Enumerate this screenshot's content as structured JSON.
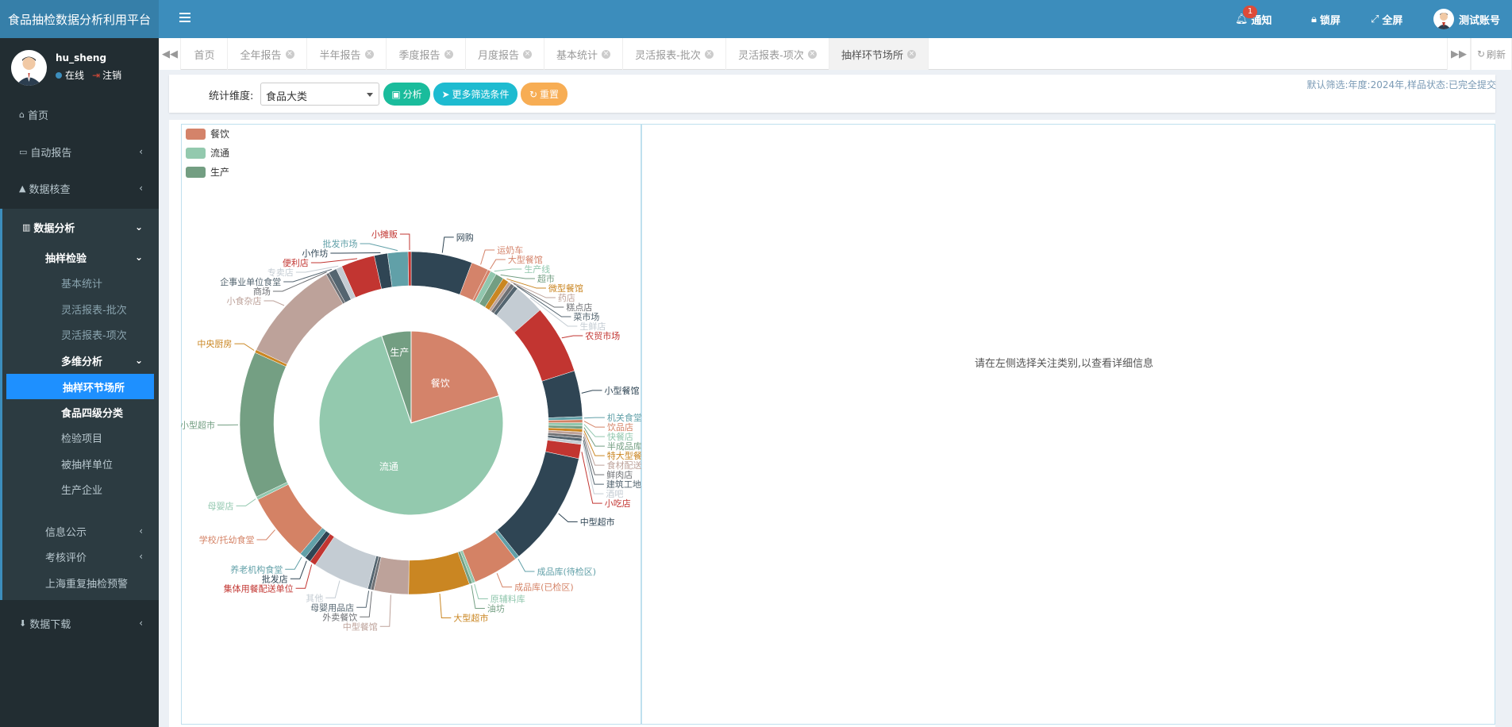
{
  "app": {
    "title": "食品抽检数据分析利用平台"
  },
  "topnav": {
    "notify": "通知",
    "notify_count": "1",
    "lock": "锁屏",
    "fullscreen": "全屏",
    "account": "测试账号"
  },
  "user": {
    "name": "hu_sheng",
    "status": "在线",
    "logout": "注销"
  },
  "sidebar": {
    "home": "首页",
    "auto_report": "自动报告",
    "data_check": "数据核查",
    "data_analysis": "数据分析",
    "sampling": "抽样检验",
    "basic_stats": "基本统计",
    "flex_batch": "灵活报表-批次",
    "flex_item": "灵活报表-项次",
    "multi": "多维分析",
    "sample_site": "抽样环节场所",
    "food_class": "食品四级分类",
    "test_item": "检验项目",
    "sampled_unit": "被抽样单位",
    "producer": "生产企业",
    "info_pub": "信息公示",
    "assessment": "考核评价",
    "shanghai": "上海重复抽检预警",
    "download": "数据下载"
  },
  "tabs": [
    "首页",
    "全年报告",
    "半年报告",
    "季度报告",
    "月度报告",
    "基本统计",
    "灵活报表-批次",
    "灵活报表-项次",
    "抽样环节场所"
  ],
  "refresh": "刷新",
  "filter": {
    "label": "统计维度:",
    "select_value": "食品大类",
    "analyze": "分析",
    "more": "更多筛选条件",
    "reset": "重置",
    "default_note": "默认筛选:年度:2024年,样品状态:已完全提交"
  },
  "detail_hint": "请在左侧选择关注类别,以查看详细信息",
  "colors": {
    "catering": "#d4836a",
    "circulation": "#93c9ae",
    "production": "#739e82",
    "primary": "#3c8dbc"
  },
  "chart_data": {
    "type": "pie",
    "legend": [
      "餐饮",
      "流通",
      "生产"
    ],
    "legend_position": "top-left",
    "inner": [
      {
        "name": "餐饮",
        "value": 20.2
      },
      {
        "name": "流通",
        "value": 74.6
      },
      {
        "name": "生产",
        "value": 5.2
      }
    ],
    "outer": [
      {
        "name": "网购",
        "value": 6.0,
        "color": "#2f4554"
      },
      {
        "name": "运奶车",
        "value": 1.7,
        "color": "#d4836a"
      },
      {
        "name": "大型餐馆",
        "value": 0.3,
        "color": "#d4836a"
      },
      {
        "name": "生产线",
        "value": 0.6,
        "color": "#91c7ae"
      },
      {
        "name": "超市",
        "value": 0.8,
        "color": "#739e82"
      },
      {
        "name": "微型餐馆",
        "value": 0.6,
        "color": "#ca8622"
      },
      {
        "name": "药店",
        "value": 0.3,
        "color": "#bda29a"
      },
      {
        "name": "糕点店",
        "value": 0.4,
        "color": "#6e7074"
      },
      {
        "name": "菜市场",
        "value": 0.4,
        "color": "#546570"
      },
      {
        "name": "生鲜店",
        "value": 3.0,
        "color": "#c4ccd3"
      },
      {
        "name": "农贸市场",
        "value": 6.8,
        "color": "#c23531"
      },
      {
        "name": "小型餐馆",
        "value": 4.5,
        "color": "#2f4554"
      },
      {
        "name": "机关食堂",
        "value": 0.3,
        "color": "#61a0a8"
      },
      {
        "name": "饮品店",
        "value": 0.3,
        "color": "#d48265"
      },
      {
        "name": "快餐店",
        "value": 0.3,
        "color": "#91c7ae"
      },
      {
        "name": "半成品库",
        "value": 0.3,
        "color": "#749f83"
      },
      {
        "name": "特大型餐馆",
        "value": 0.3,
        "color": "#ca8622"
      },
      {
        "name": "食材配送",
        "value": 0.3,
        "color": "#bda29a"
      },
      {
        "name": "鲜肉店",
        "value": 0.3,
        "color": "#6e7074"
      },
      {
        "name": "建筑工地",
        "value": 0.3,
        "color": "#546570"
      },
      {
        "name": "酒吧",
        "value": 0.3,
        "color": "#c4ccd3"
      },
      {
        "name": "小吃店",
        "value": 1.4,
        "color": "#c23531"
      },
      {
        "name": "中型超市",
        "value": 11.3,
        "color": "#2f4554"
      },
      {
        "name": "成品库(待检区)",
        "value": 0.4,
        "color": "#61a0a8"
      },
      {
        "name": "成品库(已检区)",
        "value": 4.5,
        "color": "#d48265"
      },
      {
        "name": "原辅料库",
        "value": 0.3,
        "color": "#91c7ae"
      },
      {
        "name": "油坊",
        "value": 0.3,
        "color": "#749f83"
      },
      {
        "name": "大型超市",
        "value": 6.0,
        "color": "#ca8622"
      },
      {
        "name": "中型餐馆",
        "value": 3.4,
        "color": "#bda29a"
      },
      {
        "name": "外卖餐饮",
        "value": 0.3,
        "color": "#6e7074"
      },
      {
        "name": "母婴用品店",
        "value": 0.3,
        "color": "#546570"
      },
      {
        "name": "其他",
        "value": 5.6,
        "color": "#c4ccd3"
      },
      {
        "name": "集体用餐配送单位",
        "value": 0.6,
        "color": "#c23531"
      },
      {
        "name": "批发店",
        "value": 0.6,
        "color": "#2f4554"
      },
      {
        "name": "养老机构食堂",
        "value": 0.6,
        "color": "#61a0a8"
      },
      {
        "name": "学校/托幼食堂",
        "value": 6.7,
        "color": "#d48265"
      },
      {
        "name": "母婴店",
        "value": 0.3,
        "color": "#91c7ae"
      },
      {
        "name": "小型超市",
        "value": 14.4,
        "color": "#749f83"
      },
      {
        "name": "中央厨房",
        "value": 0.3,
        "color": "#ca8622"
      },
      {
        "name": "小食杂店",
        "value": 10.1,
        "color": "#bda29a"
      },
      {
        "name": "商场",
        "value": 0.3,
        "color": "#6e7074"
      },
      {
        "name": "企事业单位食堂",
        "value": 0.8,
        "color": "#546570"
      },
      {
        "name": "专卖店",
        "value": 0.6,
        "color": "#c4ccd3"
      },
      {
        "name": "便利店",
        "value": 3.3,
        "color": "#c23531"
      },
      {
        "name": "小作坊",
        "value": 1.3,
        "color": "#2f4554"
      },
      {
        "name": "批发市场",
        "value": 2.0,
        "color": "#61a0a8"
      },
      {
        "name": "小摊贩",
        "value": 0.3,
        "color": "#c23531"
      }
    ]
  }
}
